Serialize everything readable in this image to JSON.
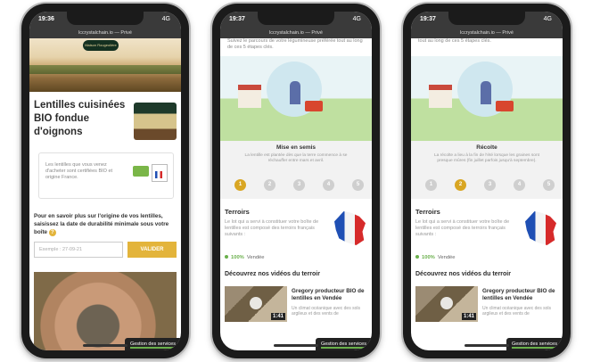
{
  "phones": [
    {
      "time": "19:36",
      "network": "4G",
      "url": "lccrystalchain.io — Privé",
      "product_title": "Lentilles cuisinées BIO fondue d'oignons",
      "certification_text": "Les lentilles que vous venez d'acheter sont certifiées BIO et origine France.",
      "lookup_text": "Pour en savoir plus sur l'origine de vos lentilles, saisissez la date de durabilité minimale sous votre boîte",
      "date_placeholder": "Exemple : 27-09-21",
      "validate_label": "VALIDER",
      "cookie_label": "Gestion des services",
      "brand_label": "Maison Rougeolière"
    },
    {
      "time": "19:37",
      "network": "4G",
      "url": "lccrystalchain.io — Privé",
      "route_text": "Suivez le parcours de votre légumineuse préférée tout au long de ces 5 étapes clés.",
      "step_title": "Mise en semis",
      "step_desc": "La lentille est plantée dès que la terre commence à se réchauffer entre mars et avril.",
      "steps": [
        "1",
        "2",
        "3",
        "4",
        "5"
      ],
      "active_step": 1,
      "terroir_title": "Terroirs",
      "terroir_desc": "Le lot qui a servi à constituer votre boîte de lentilles est composé des terroirs français suivants :",
      "percent": "100%",
      "region": "Vendée",
      "videos_title": "Découvrez nos vidéos du terroir",
      "video_title": "Gregory producteur BIO de lentilles en Vendée",
      "video_desc": "Un climat océanique avec des sols argileux et des vents de",
      "video_duration": "1:41",
      "cookie_label": "Gestion des services"
    },
    {
      "time": "19:37",
      "network": "4G",
      "url": "lccrystalchain.io — Privé",
      "route_text": "tout au long de ces 5 étapes clés.",
      "step_title": "Récolte",
      "step_desc": "La récolte a lieu à la fin de l'été lorsque les graines sont presque mûres (fin juillet parfois jusqu'à septembre).",
      "steps": [
        "1",
        "2",
        "3",
        "4",
        "5"
      ],
      "active_step": 2,
      "terroir_title": "Terroirs",
      "terroir_desc": "Le lot qui a servi à constituer votre boîte de lentilles est composé des terroirs français suivants :",
      "percent": "100%",
      "region": "Vendée",
      "videos_title": "Découvrez nos vidéos du terroir",
      "video_title": "Gregory producteur BIO de lentilles en Vendée",
      "video_desc": "Un climat océanique avec des sols argileux et des vents de",
      "video_duration": "1:41",
      "cookie_label": "Gestion des services"
    }
  ],
  "colors": {
    "accent": "#e3b43b",
    "active_step": "#d9a623",
    "green": "#6ab04c"
  }
}
